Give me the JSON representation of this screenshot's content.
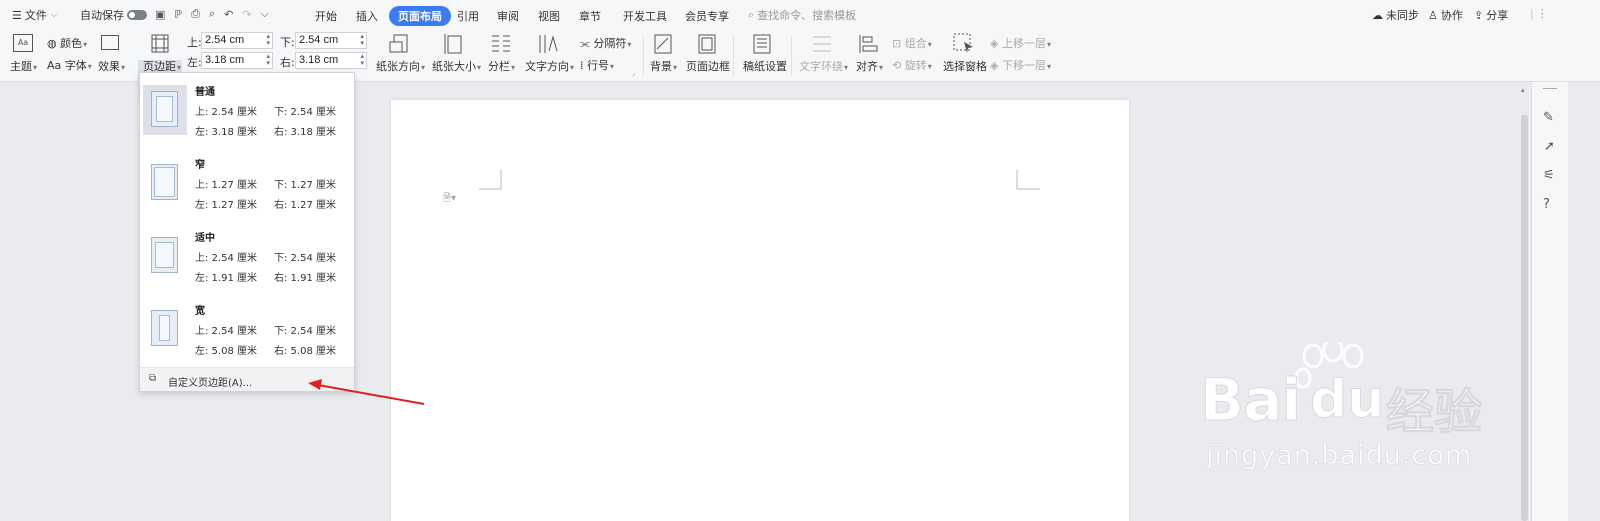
{
  "topbar": {
    "menu_label": "文件",
    "autosave_label": "自动保存",
    "tabs": [
      "开始",
      "插入",
      "页面布局",
      "引用",
      "审阅",
      "视图",
      "章节",
      "开发工具",
      "会员专享"
    ],
    "active_tab": "页面布局",
    "search_placeholder": "查找命令、搜索模板",
    "sync_label": "未同步",
    "collab_label": "协作",
    "share_label": "分享"
  },
  "ribbon": {
    "theme_label": "主题",
    "color_label": "颜色",
    "font_label": "字体",
    "font_prefix": "Aa",
    "effect_label": "效果",
    "margins_label": "页边距",
    "margin_top_label": "上:",
    "margin_top_value": "2.54 cm",
    "margin_bottom_label": "下:",
    "margin_bottom_value": "2.54 cm",
    "margin_left_label": "左:",
    "margin_left_value": "3.18 cm",
    "margin_right_label": "右:",
    "margin_right_value": "3.18 cm",
    "orientation_label": "纸张方向",
    "size_label": "纸张大小",
    "columns_label": "分栏",
    "text_direction_label": "文字方向",
    "separator_label": "分隔符",
    "line_number_label": "行号",
    "background_label": "背景",
    "page_border_label": "页面边框",
    "draft_paper_label": "稿纸设置",
    "text_wrap_label": "文字环绕",
    "align_label": "对齐",
    "group_label": "组合",
    "rotate_label": "旋转",
    "selection_pane_label": "选择窗格",
    "bring_forward_label": "上移一层",
    "send_backward_label": "下移一层"
  },
  "margin_dropdown": {
    "options": [
      {
        "name": "普通",
        "top": "上: 2.54 厘米",
        "bottom": "下: 2.54 厘米",
        "left": "左: 3.18 厘米",
        "right": "右: 3.18 厘米"
      },
      {
        "name": "窄",
        "top": "上: 1.27 厘米",
        "bottom": "下: 1.27 厘米",
        "left": "左: 1.27 厘米",
        "right": "右: 1.27 厘米"
      },
      {
        "name": "适中",
        "top": "上: 2.54 厘米",
        "bottom": "下: 2.54 厘米",
        "left": "左: 1.91 厘米",
        "right": "右: 1.91 厘米"
      },
      {
        "name": "宽",
        "top": "上: 2.54 厘米",
        "bottom": "下: 2.54 厘米",
        "left": "左: 5.08 厘米",
        "right": "右: 5.08 厘米"
      }
    ],
    "selected_option": "普通",
    "custom_label": "自定义页边距(A)..."
  },
  "watermark": {
    "brand_latin": "Bai",
    "brand_du": "du",
    "brand_cn": "经验",
    "url": "jingyan.baidu.com"
  },
  "colors": {
    "accent": "#3d7bf3",
    "arrow": "#e02020"
  }
}
